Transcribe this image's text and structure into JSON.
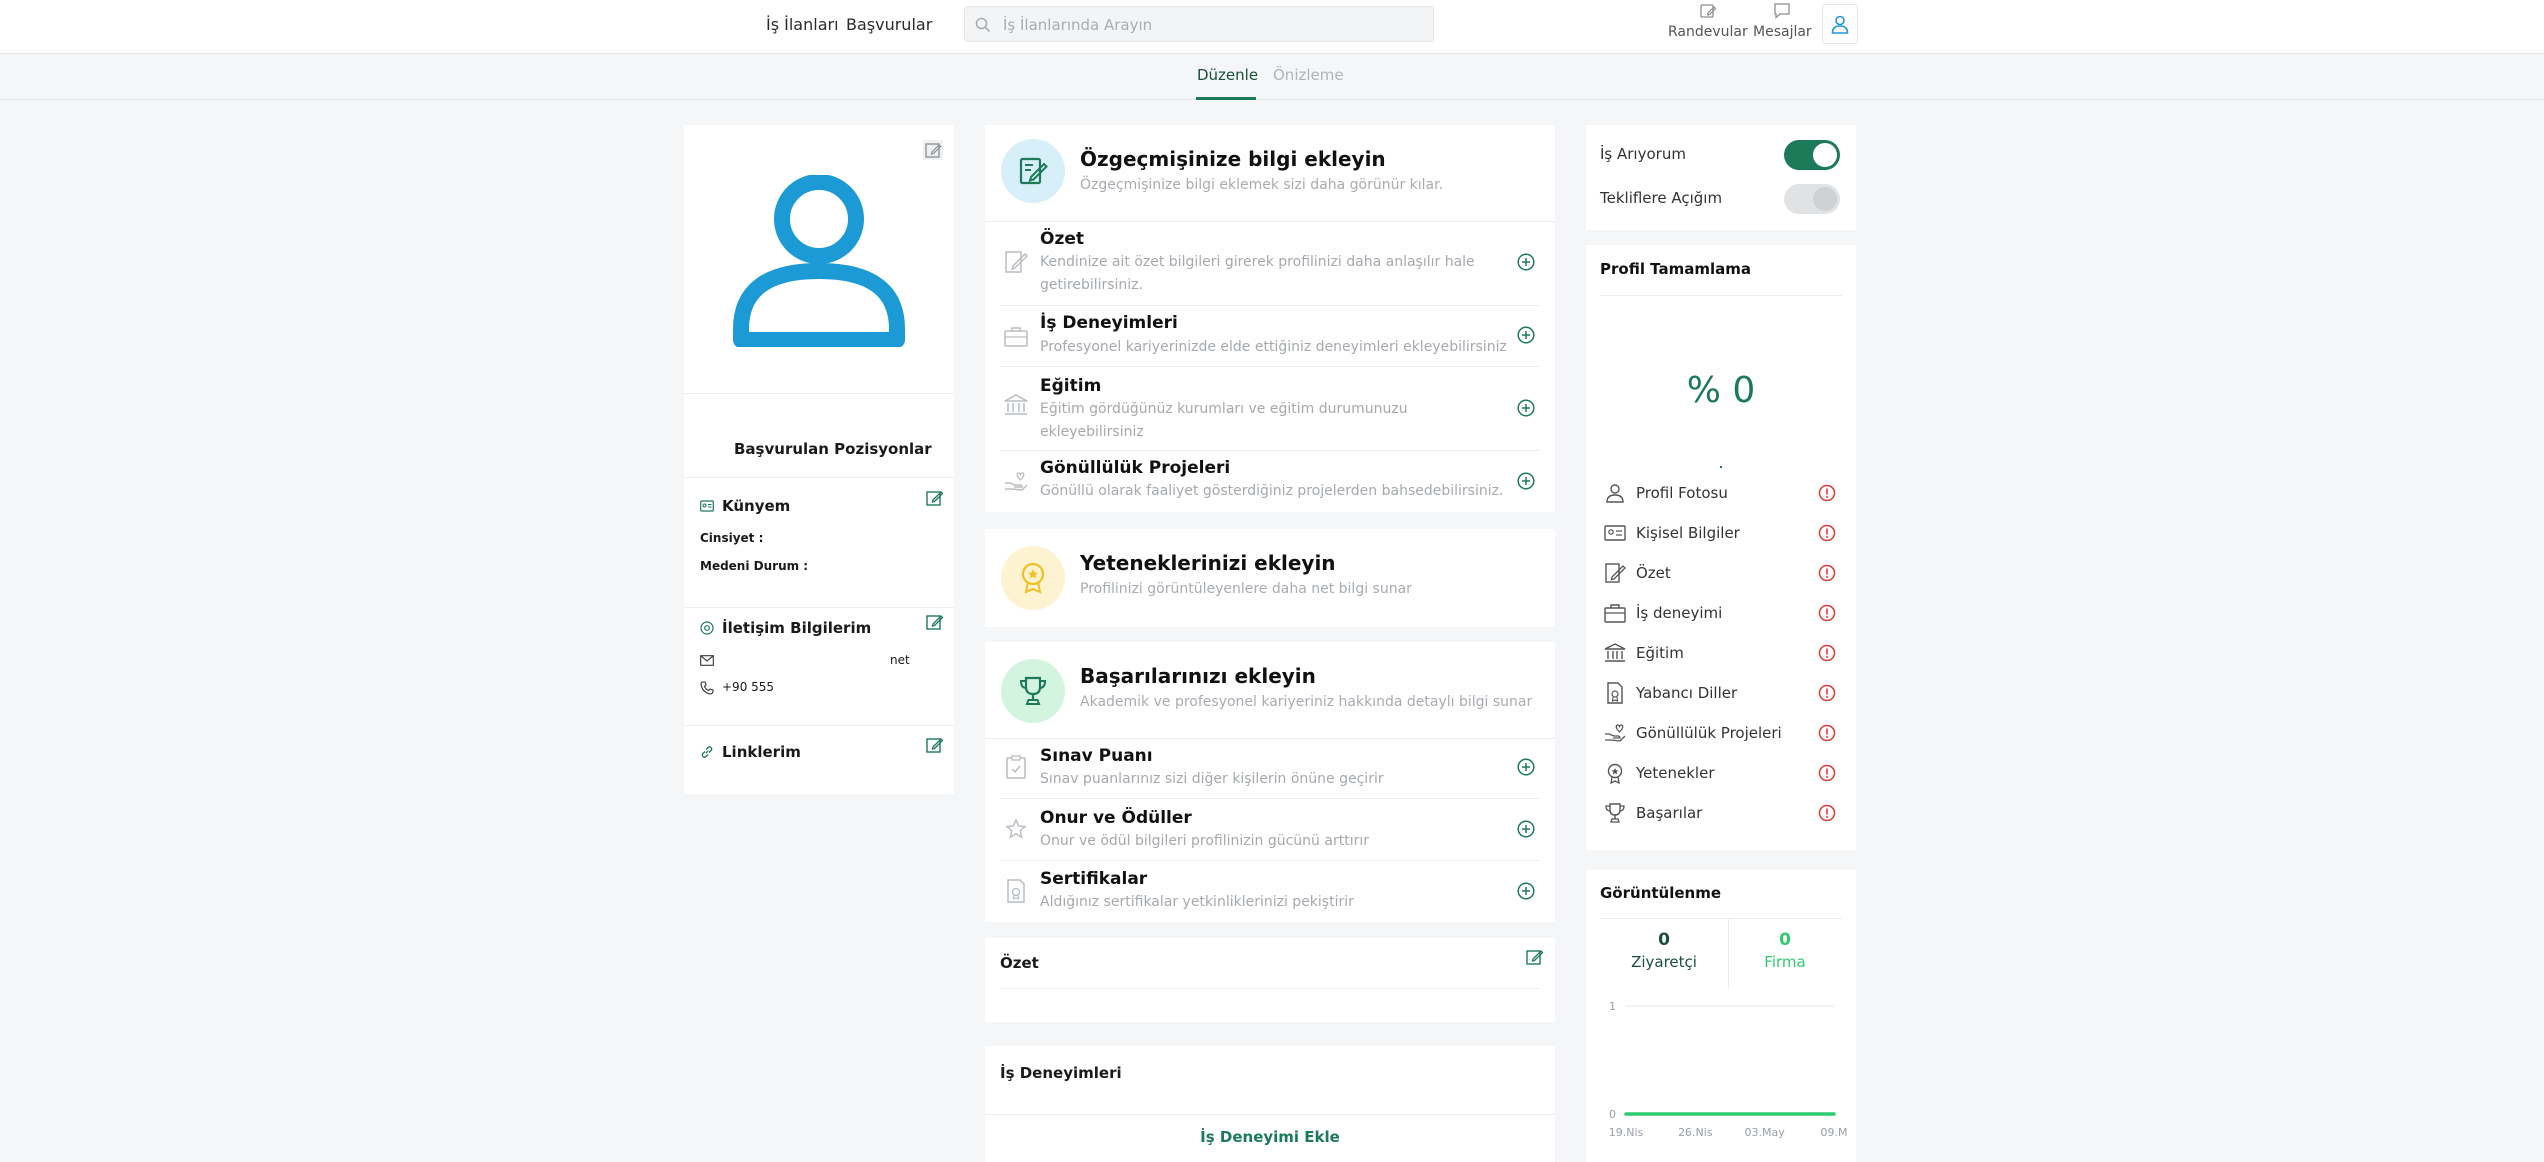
{
  "nav": {
    "links": [
      "İş İlanları",
      "Başvurular"
    ],
    "search_placeholder": "İş İlanlarında Arayın",
    "appointments_label": "Randevular",
    "messages_label": "Mesajlar"
  },
  "tabs": {
    "edit": "Düzenle",
    "preview": "Önizleme"
  },
  "left": {
    "applied_positions": "Başvurulan Pozisyonlar",
    "kunyem_title": "Künyem",
    "gender_label": "Cinsiyet :",
    "marital_label": "Medeni Durum :",
    "contact_title": "İletişim Bilgilerim",
    "email_value": "net",
    "phone_value": "+90 555",
    "links_title": "Linklerim"
  },
  "middle": {
    "resume": {
      "title": "Özgeçmişinize bilgi ekleyin",
      "subtitle": "Özgeçmişinize bilgi eklemek sizi daha görünür kılar.",
      "items": [
        {
          "title": "Özet",
          "desc": "Kendinize ait özet bilgileri girerek profilinizi daha anlaşılır hale getirebilirsiniz."
        },
        {
          "title": "İş Deneyimleri",
          "desc": "Profesyonel kariyerinizde elde ettiğiniz deneyimleri ekleyebilirsiniz"
        },
        {
          "title": "Eğitim",
          "desc": "Eğitim gördüğünüz kurumları ve eğitim durumunuzu ekleyebilirsiniz"
        },
        {
          "title": "Gönüllülük Projeleri",
          "desc": "Gönüllü olarak faaliyet gösterdiğiniz projelerden bahsedebilirsiniz."
        }
      ]
    },
    "skills": {
      "title": "Yeteneklerinizi ekleyin",
      "subtitle": "Profilinizi görüntüleyenlere daha net bilgi sunar"
    },
    "achievements": {
      "title": "Başarılarınızı ekleyin",
      "subtitle": "Akademik ve profesyonel kariyeriniz hakkında detaylı bilgi sunar",
      "items": [
        {
          "title": "Sınav Puanı",
          "desc": "Sınav puanlarınız sizi diğer kişilerin önüne geçirir"
        },
        {
          "title": "Onur ve Ödüller",
          "desc": "Onur ve ödül bilgileri profilinizin gücünü arttırır"
        },
        {
          "title": "Sertifikalar",
          "desc": "Aldığınız sertifikalar yetkinliklerinizi pekiştirir"
        }
      ]
    },
    "summary_title": "Özet",
    "experience_title": "İş Deneyimleri",
    "experience_add": "İş Deneyimi Ekle"
  },
  "right": {
    "job_seeking_label": "İş Arıyorum",
    "job_seeking_on": true,
    "open_offers_label": "Tekliflere Açığım",
    "open_offers_on": false,
    "completion_title": "Profil Tamamlama",
    "completion_percent": "% 0",
    "completion_items": [
      "Profil Fotosu",
      "Kişisel Bilgiler",
      "Özet",
      "İş deneyimi",
      "Eğitim",
      "Yabancı Diller",
      "Gönüllülük Projeleri",
      "Yetenekler",
      "Başarılar"
    ],
    "views_title": "Görüntülenme",
    "visitors_count": "0",
    "visitors_label": "Ziyaretçi",
    "companies_count": "0",
    "companies_label": "Firma"
  },
  "chart_data": {
    "type": "line",
    "categories": [
      "19.Nis",
      "26.Nis",
      "03.May",
      "09.M"
    ],
    "series": [
      {
        "values": [
          0,
          0,
          0,
          0
        ]
      }
    ],
    "ylim": [
      0,
      1
    ],
    "yticks": [
      "1",
      "0"
    ]
  },
  "colors": {
    "accent": "#1d7a58",
    "avatar": "#1c9ad6",
    "warning": "#e03b3b"
  }
}
